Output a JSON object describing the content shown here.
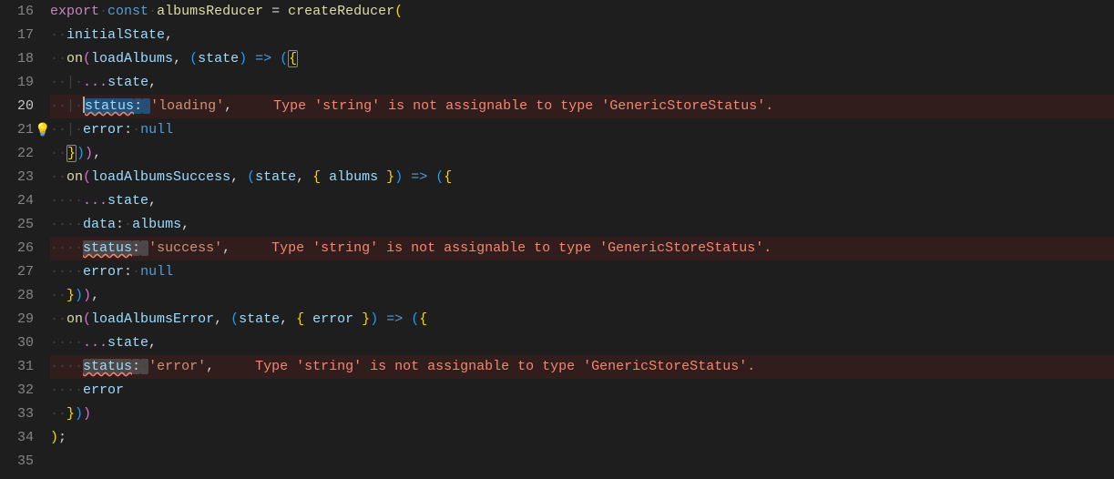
{
  "lineNumbers": [
    "16",
    "17",
    "18",
    "19",
    "20",
    "21",
    "22",
    "23",
    "24",
    "25",
    "26",
    "27",
    "28",
    "29",
    "30",
    "31",
    "32",
    "33",
    "34",
    "35"
  ],
  "activeLine": "20",
  "lightbulbLine": "21",
  "code": {
    "l16": {
      "kw_export": "export",
      "kw_const": "const",
      "var": "albumsReducer",
      "eq": " = ",
      "fn": "createReducer",
      "open": "("
    },
    "l17": {
      "param": "initialState",
      "comma": ","
    },
    "l18": {
      "fn": "on",
      "open": "(",
      "arg": "loadAlbums",
      "comma": ", ",
      "popen": "(",
      "p": "state",
      "pclose": ")",
      "arrow": " => ",
      "ropen": "(",
      "bopen": "{"
    },
    "l19": {
      "dots": "...",
      "p": "state",
      "comma": ","
    },
    "l20": {
      "prop": "status",
      "colon": ": ",
      "val": "'loading'",
      "comma": ",",
      "err": "Type 'string' is not assignable to type 'GenericStoreStatus'."
    },
    "l21": {
      "prop": "error",
      "colon": ": ",
      "val": "null"
    },
    "l22": {
      "bclose": "}",
      "rclose": ")",
      "fclose": ")",
      "comma": ","
    },
    "l23": {
      "fn": "on",
      "open": "(",
      "arg": "loadAlbumsSuccess",
      "comma": ", ",
      "popen": "(",
      "p1": "state",
      "c2": ", ",
      "dopen": "{ ",
      "p2": "albums",
      "dclose": " }",
      "pclose": ")",
      "arrow": " => ",
      "ropen": "(",
      "bopen": "{"
    },
    "l24": {
      "dots": "...",
      "p": "state",
      "comma": ","
    },
    "l25": {
      "prop": "data",
      "colon": ": ",
      "val": "albums",
      "comma": ","
    },
    "l26": {
      "prop": "status",
      "colon": ": ",
      "val": "'success'",
      "comma": ",",
      "err": "Type 'string' is not assignable to type 'GenericStoreStatus'."
    },
    "l27": {
      "prop": "error",
      "colon": ": ",
      "val": "null"
    },
    "l28": {
      "bclose": "}",
      "rclose": ")",
      "fclose": ")",
      "comma": ","
    },
    "l29": {
      "fn": "on",
      "open": "(",
      "arg": "loadAlbumsError",
      "comma": ", ",
      "popen": "(",
      "p1": "state",
      "c2": ", ",
      "dopen": "{ ",
      "p2": "error",
      "dclose": " }",
      "pclose": ")",
      "arrow": " => ",
      "ropen": "(",
      "bopen": "{"
    },
    "l30": {
      "dots": "...",
      "p": "state",
      "comma": ","
    },
    "l31": {
      "prop": "status",
      "colon": ": ",
      "val": "'error'",
      "comma": ",",
      "err": "Type 'string' is not assignable to type 'GenericStoreStatus'."
    },
    "l32": {
      "prop": "error"
    },
    "l33": {
      "bclose": "}",
      "rclose": ")",
      "fclose": ")"
    },
    "l34": {
      "close": ")",
      "semi": ";"
    }
  },
  "ws": {
    "d2": "··",
    "d4": "····",
    "pipe": "|"
  }
}
